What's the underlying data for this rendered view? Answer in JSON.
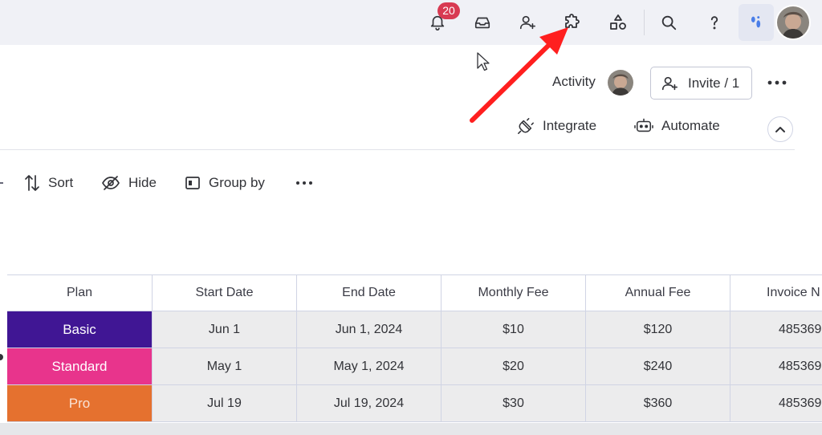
{
  "header": {
    "notifications_count": "20"
  },
  "board": {
    "activity_label": "Activity",
    "invite_label": "Invite / 1",
    "integrate_label": "Integrate",
    "automate_label": "Automate"
  },
  "toolbar": {
    "sort_label": "Sort",
    "hide_label": "Hide",
    "group_by_label": "Group by"
  },
  "table": {
    "columns": [
      "Plan",
      "Start Date",
      "End Date",
      "Monthly Fee",
      "Annual Fee",
      "Invoice N"
    ],
    "rows": [
      {
        "plan": "Basic",
        "plan_color": "#401694",
        "start": "Jun 1",
        "end": "Jun 1, 2024",
        "monthly": "$10",
        "annual": "$120",
        "invoice": "485369"
      },
      {
        "plan": "Standard",
        "plan_color": "#e8348c",
        "start": "May 1",
        "end": "May 1, 2024",
        "monthly": "$20",
        "annual": "$240",
        "invoice": "485369"
      },
      {
        "plan": "Pro",
        "plan_color": "#e5712f",
        "start": "Jul 19",
        "end": "Jul 19, 2024",
        "monthly": "$30",
        "annual": "$360",
        "invoice": "485369"
      }
    ]
  },
  "icons": {
    "notifications": "bell-icon",
    "inbox": "inbox-icon",
    "invite_members": "person-plus-icon",
    "apps": "puzzle-icon",
    "marketplace": "apps-shapes-icon",
    "search": "search-icon",
    "help": "question-icon",
    "brand": "brand-logo-icon",
    "annotation": "red-arrow-icon",
    "cursor": "mouse-cursor-icon"
  },
  "colors": {
    "accent_red": "#ff1f1f",
    "badge": "#d83a52",
    "header_bg": "#f0f1f6"
  }
}
